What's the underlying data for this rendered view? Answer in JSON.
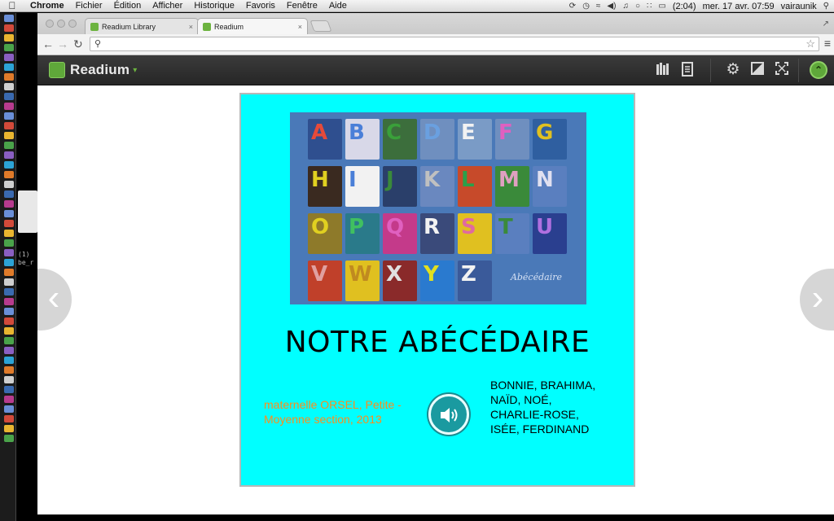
{
  "menubar": {
    "app_name": "Chrome",
    "items": [
      "Fichier",
      "Édition",
      "Afficher",
      "Historique",
      "Favoris",
      "Fenêtre",
      "Aide"
    ],
    "battery": "(2:04)",
    "datetime": "mer. 17 avr.  07:59",
    "user": "vairaunik"
  },
  "sliver": {
    "text": "(1)\nbe_r"
  },
  "tabs": [
    {
      "label": "Readium Library",
      "close": "×"
    },
    {
      "label": "Readium",
      "close": "×"
    }
  ],
  "omnibox": {
    "value": "",
    "placeholder": ""
  },
  "readium": {
    "logo_text": "Readium",
    "icons": [
      "library-icon",
      "toc-icon",
      "settings-icon",
      "contrast-icon",
      "fullscreen-icon",
      "collapse-icon"
    ]
  },
  "cover": {
    "letters": [
      "A",
      "B",
      "C",
      "D",
      "E",
      "F",
      "G",
      "H",
      "I",
      "J",
      "K",
      "L",
      "M",
      "N",
      "O",
      "P",
      "Q",
      "R",
      "S",
      "T",
      "U",
      "V",
      "W",
      "X",
      "Y",
      "Z"
    ],
    "signature": "Abécédaire",
    "title": "NOTRE ABÉCÉDAIRE",
    "school": "maternelle ORSEL, Petite - Moyenne section, 2013",
    "authors": "BONNIE, BRAHIMA, NAÏD, NOÉ, CHARLIE-ROSE, ISÉE, FERDINAND"
  },
  "colors": {
    "page_bg": "#00ffff",
    "school_text": "#ff8c1a",
    "readium_green": "#5fa83a",
    "audio_button": "#1a9aa0"
  }
}
